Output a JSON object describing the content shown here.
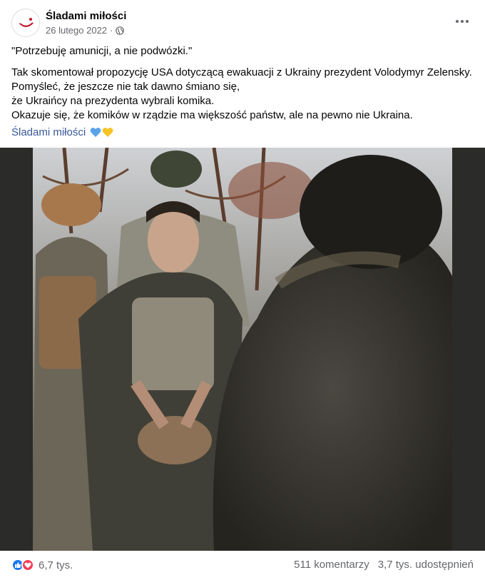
{
  "post": {
    "page_name": "Śladami miłości",
    "date": "26 lutego 2022",
    "date_separator": "·",
    "privacy_icon": "globe-icon",
    "more_icon": "more-options-icon"
  },
  "text": {
    "line1": "\"Potrzebuję amunicji, a nie podwózki.\"",
    "line2": "Tak skomentował propozycję USA dotyczącą ewakuacji z Ukrainy prezydent Volodymyr Zelensky.",
    "line3": "Pomyśleć, że jeszcze nie tak dawno śmiano się,",
    "line4": "że Ukraińcy na prezydenta wybrali komika.",
    "line5": "Okazuje się, że komików w rządzie ma większość państw, ale na pewno nie Ukraina.",
    "signature": "Śladami miłości",
    "signature_icons": [
      "blue-heart-icon",
      "yellow-heart-icon"
    ]
  },
  "photo": {
    "icon": "photo-soldiers-forest"
  },
  "footer": {
    "reaction_icons": [
      "like-icon",
      "love-icon"
    ],
    "reaction_count": "6,7 tys.",
    "comments": "511 komentarzy",
    "shares": "3,7 tys. udostępnień"
  },
  "colors": {
    "link": "#385898",
    "secondary_text": "#65676b",
    "like_blue": "#1877f2",
    "love_red": "#f33e58",
    "heart_blue": "#5ba3e8",
    "heart_yellow": "#f7c325"
  }
}
